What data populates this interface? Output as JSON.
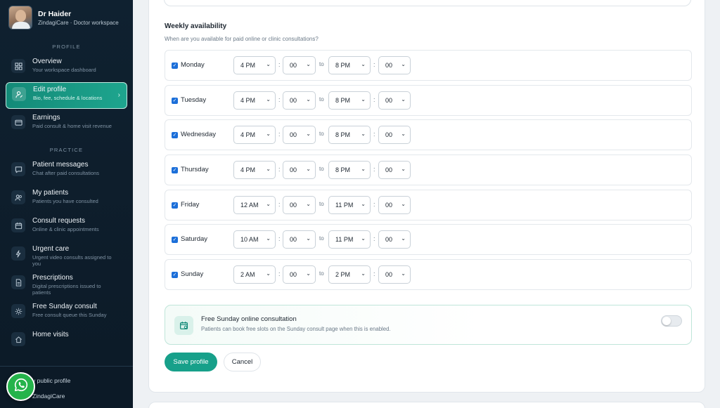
{
  "sidebar": {
    "user_name": "Dr Haider",
    "user_sub": "ZindagiCare · Doctor workspace",
    "section_profile": "PROFILE",
    "section_practice": "PRACTICE",
    "items": [
      {
        "title": "Overview",
        "desc": "Your workspace dashboard",
        "icon": "grid-icon"
      },
      {
        "title": "Edit profile",
        "desc": "Bio, fee, schedule & locations",
        "icon": "user-edit-icon"
      },
      {
        "title": "Earnings",
        "desc": "Paid consult & home visit revenue",
        "icon": "wallet-icon"
      },
      {
        "title": "Patient messages",
        "desc": "Chat after paid consultations",
        "icon": "chat-icon"
      },
      {
        "title": "My patients",
        "desc": "Patients you have consulted",
        "icon": "users-icon"
      },
      {
        "title": "Consult requests",
        "desc": "Online & clinic appointments",
        "icon": "calendar-icon"
      },
      {
        "title": "Urgent care",
        "desc": "Urgent video consults assigned to you",
        "icon": "bolt-icon"
      },
      {
        "title": "Prescriptions",
        "desc": "Digital prescriptions issued to patients",
        "icon": "document-icon"
      },
      {
        "title": "Free Sunday consult",
        "desc": "Free consult queue this Sunday",
        "icon": "sun-icon"
      },
      {
        "title": "Home visits",
        "desc": "",
        "icon": "home-icon"
      }
    ],
    "bottom_link_1": "y public profile",
    "bottom_link_2": "ZindagiCare"
  },
  "availability": {
    "title": "Weekly availability",
    "subtitle": "When are you available for paid online or clinic consultations?",
    "to_label": "to",
    "colon": ":",
    "days": [
      {
        "name": "Monday",
        "checked": true,
        "from_hour": "4 PM",
        "from_min": "00",
        "to_hour": "8 PM",
        "to_min": "00"
      },
      {
        "name": "Tuesday",
        "checked": true,
        "from_hour": "4 PM",
        "from_min": "00",
        "to_hour": "8 PM",
        "to_min": "00"
      },
      {
        "name": "Wednesday",
        "checked": true,
        "from_hour": "4 PM",
        "from_min": "00",
        "to_hour": "8 PM",
        "to_min": "00"
      },
      {
        "name": "Thursday",
        "checked": true,
        "from_hour": "4 PM",
        "from_min": "00",
        "to_hour": "8 PM",
        "to_min": "00"
      },
      {
        "name": "Friday",
        "checked": true,
        "from_hour": "12 AM",
        "from_min": "00",
        "to_hour": "11 PM",
        "to_min": "00"
      },
      {
        "name": "Saturday",
        "checked": true,
        "from_hour": "10 AM",
        "from_min": "00",
        "to_hour": "11 PM",
        "to_min": "00"
      },
      {
        "name": "Sunday",
        "checked": true,
        "from_hour": "2 AM",
        "from_min": "00",
        "to_hour": "2 PM",
        "to_min": "00"
      }
    ]
  },
  "free_sunday": {
    "title": "Free Sunday online consultation",
    "subtitle": "Patients can book free slots on the Sunday consult page when this is enabled.",
    "enabled": false
  },
  "actions": {
    "save_label": "Save profile",
    "cancel_label": "Cancel"
  },
  "colors": {
    "accent": "#17a08a",
    "sidebar_bg": "#0f2130",
    "whatsapp": "#25b34b"
  }
}
